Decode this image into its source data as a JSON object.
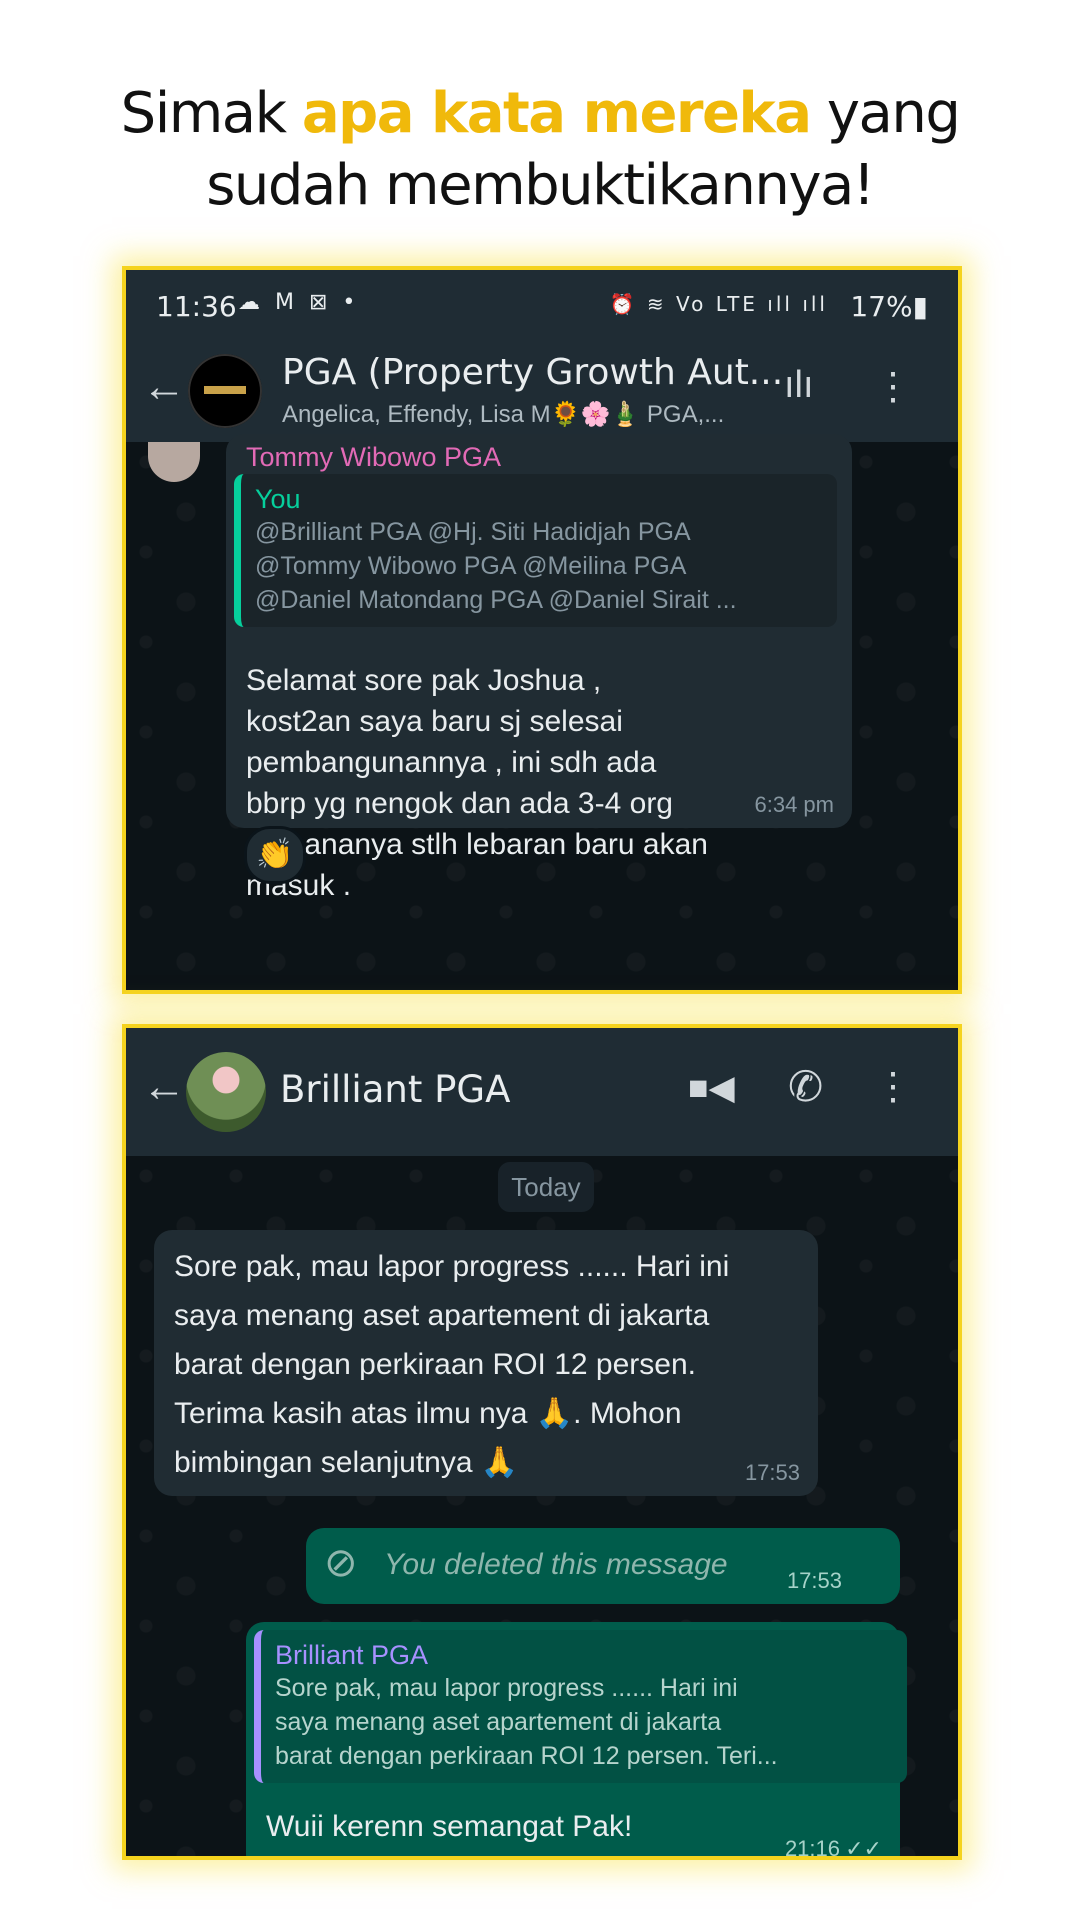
{
  "headline": {
    "before": "Simak ",
    "highlight": "apa kata mereka",
    "after": " yang",
    "line2": "sudah membuktikannya!"
  },
  "colors": {
    "highlight": "#f0b90b",
    "frame": "#f5d31e",
    "bubble_out": "#005c4b",
    "bubble_in": "#202c33"
  },
  "shot1": {
    "statusbar": {
      "time": "11:36",
      "left_icons": "☁ M ⊠ •",
      "right_icons": "⏰ ≋ Vo LTE ıll ıll",
      "battery": "17%▮"
    },
    "appbar": {
      "back_icon": "←",
      "title": "PGA (Property Growth Aut...",
      "subtitle": "Angelica, Effendy, Lisa M🌻🌸🎍 PGA,...",
      "voice_icon": "ılı",
      "menu_icon": "⋮"
    },
    "message": {
      "sender": "Tommy Wibowo PGA",
      "quote_name": "You",
      "quote_text": "@Brilliant PGA @Hj. Siti Hadidjah PGA\n@Tommy Wibowo PGA @Meilina PGA\n@Daniel Matondang PGA @Daniel Sirait ...",
      "text": "Selamat sore pak Joshua ,\nkost2an saya baru sj selesai\npembangunannya , ini sdh ada\nbbrp yg nengok dan ada 3-4 org\nrencananya stlh lebaran baru akan\nmasuk .",
      "time": "6:34 pm",
      "reaction": "👏"
    }
  },
  "shot2": {
    "appbar": {
      "back_icon": "←",
      "title": "Brilliant PGA",
      "video_icon": "■◀",
      "call_icon": "✆",
      "menu_icon": "⋮"
    },
    "day_chip": "Today",
    "incoming": {
      "text": "Sore pak, mau lapor progress ...... Hari ini\nsaya menang aset apartement di jakarta\nbarat dengan perkiraan ROI 12 persen.\nTerima kasih atas ilmu nya 🙏. Mohon\nbimbingan selanjutnya 🙏",
      "time": "17:53"
    },
    "deleted": {
      "icon": "⊘",
      "text": "You deleted this message",
      "time": "17:53"
    },
    "reply": {
      "quote_name": "Brilliant PGA",
      "quote_text": "Sore pak, mau lapor progress ...... Hari ini\nsaya menang aset apartement di jakarta\nbarat dengan perkiraan ROI 12 persen. Teri...",
      "text": "Wuii kerenn  semangat Pak!",
      "time": "21:16",
      "ticks": "✓✓"
    }
  }
}
